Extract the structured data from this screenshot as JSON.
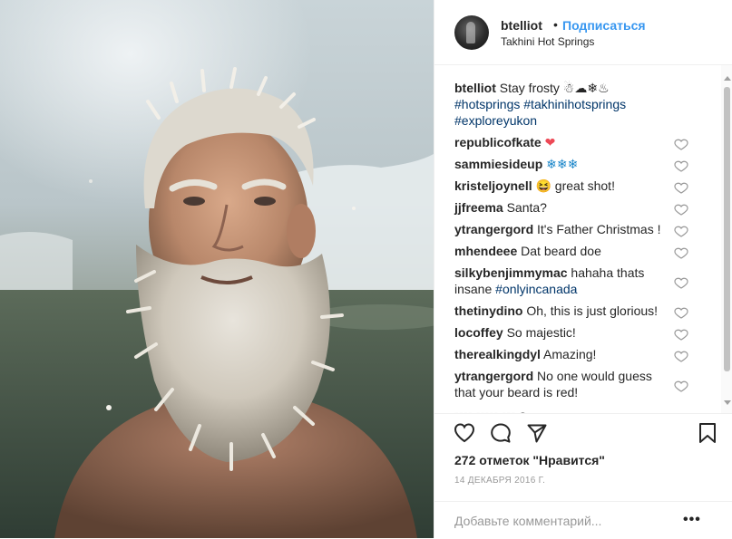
{
  "post": {
    "username": "btelliot",
    "separator": "•",
    "follow_label": "Подписаться",
    "location": "Takhini Hot Springs",
    "caption": {
      "username": "btelliot",
      "text": "Stay frosty ☃☁❄♨",
      "hashtags_line1": "#hotsprings #takhinihotsprings",
      "hashtags_line2": "#exploreyukon"
    },
    "comments": [
      {
        "user": "republicofkate",
        "text": "❤"
      },
      {
        "user": "sammiesideup",
        "text": "❄❄❄"
      },
      {
        "user": "kristeljoynell",
        "text": "😆 great shot!"
      },
      {
        "user": "jjfreema",
        "text": "Santa?"
      },
      {
        "user": "ytrangergord",
        "text": "It's Father Christmas !"
      },
      {
        "user": "mhendeee",
        "text": "Dat beard doe"
      },
      {
        "user": "silkybenjimmymac",
        "text": "hahaha thats",
        "text_line2": "insane",
        "hashtag": "#onlyincanada"
      },
      {
        "user": "thetinydino",
        "text": "Oh, this is just glorious!"
      },
      {
        "user": "locoffey",
        "text": "So majestic!"
      },
      {
        "user": "therealkingdyl",
        "text": "Amazing!"
      },
      {
        "user": "ytrangergord",
        "text": "No one would guess",
        "text_line2": "that your beard is red!"
      }
    ],
    "likes_text": "272 отметок \"Нравится\"",
    "date": "14 ДЕКАБРЯ 2016 Г.",
    "add_comment_placeholder": "Добавьте комментарий...",
    "more_label": "•••"
  },
  "icons": {
    "like": "heart-outline-icon",
    "comment": "speech-bubble-icon",
    "share": "share-arrow-icon",
    "save": "bookmark-icon",
    "comment_like": "small-heart-icon"
  },
  "colors": {
    "link_blue": "#3897f0",
    "hashtag": "#003569",
    "heart_red": "#ed4956",
    "snowflake": "#1b86c9"
  }
}
